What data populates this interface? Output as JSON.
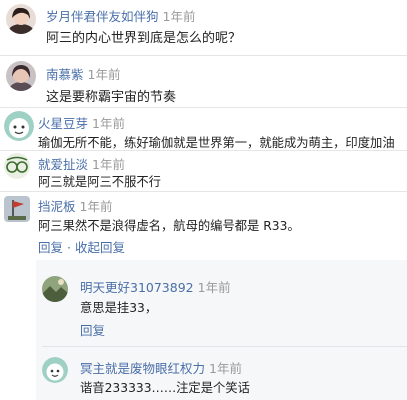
{
  "comments": [
    {
      "name": "岁月伴君伴友如伴狗",
      "time": "1年前",
      "text": "阿三的内心世界到底是怎么的呢？",
      "avatar": "woman-photo-avatar"
    },
    {
      "name": "南慕紫",
      "time": "1年前",
      "text": "这是要称霸宇宙的节奏",
      "avatar": "woman-photo-avatar"
    },
    {
      "name": "火星豆芽",
      "time": "1年前",
      "text": "瑜伽无所不能，练好瑜伽就是世界第一，就能成为萌主，印度加油",
      "avatar": "cartoon-face-avatar"
    },
    {
      "name": "就爱扯淡",
      "time": "1年前",
      "text": "阿三就是阿三不服不行",
      "avatar": "glasses-cartoon-avatar"
    },
    {
      "name": "挡泥板",
      "time": "1年前",
      "text": "阿三果然不是浪得虚名，航母的编号都是 R33。",
      "avatar": "flag-avatar",
      "actions": {
        "reply": "回复",
        "separator": "·",
        "collapse": "收起回复"
      }
    }
  ],
  "replies": [
    {
      "name": "明天更好31073892",
      "time": "1年前",
      "text": "意思是挂33，",
      "reply_label": "回复",
      "avatar": "landscape-photo-avatar"
    },
    {
      "name": "冥主就是废物眼红权力",
      "time": "1年前",
      "text": "谐音233333……注定是个笑话",
      "avatar": "cartoon-face-avatar"
    }
  ]
}
